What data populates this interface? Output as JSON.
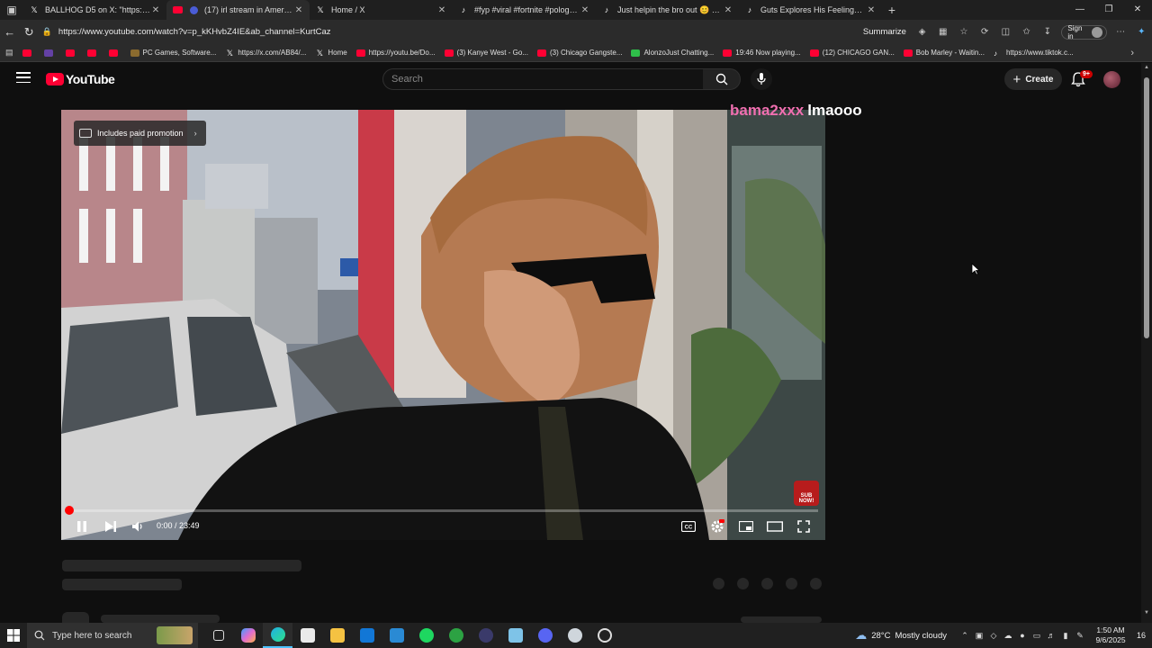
{
  "browser": {
    "tabs": [
      {
        "title": "BALLHOG D5 on X: \"https://t.co/…",
        "icon": "x-icon",
        "active": false
      },
      {
        "title": "(17) irl stream in America us…",
        "icon": "youtube-icon",
        "active": true
      },
      {
        "title": "Home / X",
        "icon": "x-icon",
        "active": false
      },
      {
        "title": "#fyp #viral #fortnite #polog #be…",
        "icon": "tiktok-icon",
        "active": false
      },
      {
        "title": "Just helpin the bro out 😊 #fyp #…",
        "icon": "tiktok-icon",
        "active": false
      },
      {
        "title": "Guts Explores His Feelings About…",
        "icon": "tiktok-icon",
        "active": false
      }
    ],
    "url": "https://www.youtube.com/watch?v=p_kKHvbZ4IE&ab_channel=KurtCaz",
    "summarize_label": "Summarize",
    "sign_in_label": "Sign in"
  },
  "bookmarks": [
    {
      "label": "",
      "icon": "yt"
    },
    {
      "label": "",
      "icon": "tl"
    },
    {
      "label": "",
      "icon": "yt"
    },
    {
      "label": "",
      "icon": "yt"
    },
    {
      "label": "",
      "icon": "yt"
    },
    {
      "label": "PC Games, Software...",
      "icon": "pc"
    },
    {
      "label": "https://x.com/AB84/...",
      "icon": "tw"
    },
    {
      "label": "Home",
      "icon": "tw"
    },
    {
      "label": "https://youtu.be/Do...",
      "icon": "yt"
    },
    {
      "label": "(3) Kanye West - Go...",
      "icon": "yt"
    },
    {
      "label": "(3) Chicago Gangste...",
      "icon": "yt"
    },
    {
      "label": "AlonzoJust Chatting...",
      "icon": "gr"
    },
    {
      "label": "19:46 Now playing...",
      "icon": "yt"
    },
    {
      "label": "(12) CHICAGO GAN...",
      "icon": "yt"
    },
    {
      "label": "Bob Marley - Waitin...",
      "icon": "yt"
    },
    {
      "label": "https://www.tiktok.c...",
      "icon": "tt"
    }
  ],
  "youtube": {
    "logo_text": "YouTube",
    "search_placeholder": "Search",
    "create_label": "Create",
    "notification_count": "9+"
  },
  "player": {
    "paid_promotion_label": "Includes paid promotion",
    "overlay_user": "bama2xxx",
    "overlay_message": "lmaooo",
    "sub_now_label": "SUB NOW!",
    "time_display": "0:00 / 23:49",
    "progress": 0.002
  },
  "taskbar": {
    "search_placeholder": "Type here to search",
    "weather_temp": "28°C",
    "weather_desc": "Mostly cloudy",
    "time": "1:50 AM",
    "date": "9/6/2025",
    "notification_count": "16"
  }
}
